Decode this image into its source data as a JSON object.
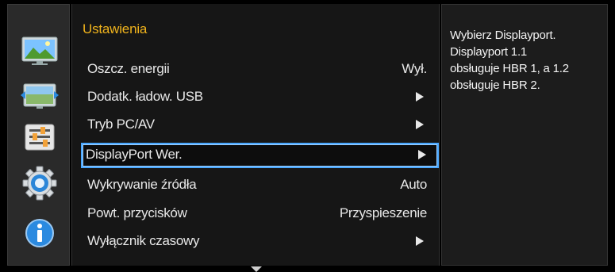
{
  "menu": {
    "title": "Ustawienia",
    "items": [
      {
        "label": "Oszcz. energii",
        "value": "Wył.",
        "has_arrow": false
      },
      {
        "label": "Dodatk. ładow. USB",
        "value": "",
        "has_arrow": true
      },
      {
        "label": "Tryb PC/AV",
        "value": "",
        "has_arrow": true
      },
      {
        "label": "DisplayPort Wer.",
        "value": "",
        "has_arrow": true,
        "selected": true
      },
      {
        "label": "Wykrywanie źródła",
        "value": "Auto",
        "has_arrow": false
      },
      {
        "label": "Powt. przycisków",
        "value": "Przyspieszenie",
        "has_arrow": false
      },
      {
        "label": "Wyłącznik czasowy",
        "value": "",
        "has_arrow": true
      }
    ]
  },
  "help": {
    "text": "Wybierz Displayport.\nDisplayport 1.1\nobsługuje HBR 1, a 1.2\nobsługuje HBR 2."
  },
  "sidebar": {
    "icons": [
      "picture-icon",
      "position-icon",
      "system-sliders-icon",
      "settings-gear-icon",
      "information-icon"
    ]
  },
  "colors": {
    "title": "#f0b31c",
    "selection_border": "#4aa8ff",
    "background": "#000000"
  }
}
